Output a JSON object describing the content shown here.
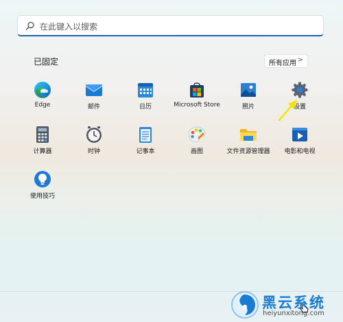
{
  "search": {
    "placeholder": "在此键入以搜索",
    "icon": "search-icon"
  },
  "pinned": {
    "title": "已固定",
    "all_apps_label": "所有应用",
    "all_apps_icon": "chevron-right-icon",
    "apps": [
      {
        "label": "Edge",
        "icon": "edge-icon"
      },
      {
        "label": "邮件",
        "icon": "mail-icon"
      },
      {
        "label": "日历",
        "icon": "calendar-icon"
      },
      {
        "label": "Microsoft Store",
        "icon": "store-icon"
      },
      {
        "label": "照片",
        "icon": "photos-icon"
      },
      {
        "label": "设置",
        "icon": "gear-icon"
      },
      {
        "label": "计算器",
        "icon": "calculator-icon"
      },
      {
        "label": "时钟",
        "icon": "clock-icon"
      },
      {
        "label": "记事本",
        "icon": "notepad-icon"
      },
      {
        "label": "画图",
        "icon": "paint-icon"
      },
      {
        "label": "文件资源管理器",
        "icon": "folder-icon"
      },
      {
        "label": "电影和电视",
        "icon": "movies-icon"
      },
      {
        "label": "使用技巧",
        "icon": "tips-icon"
      }
    ]
  },
  "watermark": {
    "brand": "黑云系统",
    "url": "heiyunxitong.com"
  },
  "colors": {
    "accent": "#1f5fa8",
    "arrow": "#f5e400",
    "brand": "#1a7bd2"
  }
}
